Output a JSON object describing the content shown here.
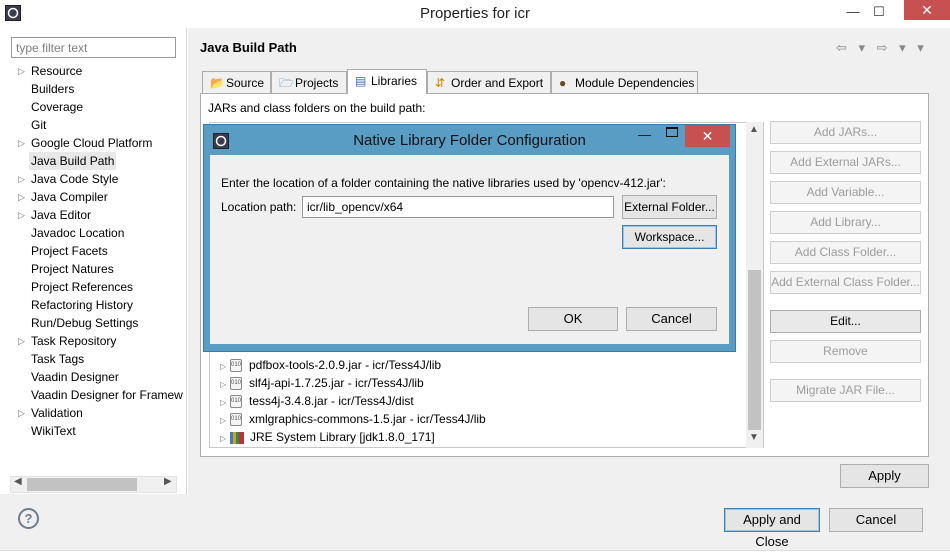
{
  "window": {
    "title": "Properties for icr",
    "minimize": "—",
    "maximize": "☐",
    "close": "✕"
  },
  "filter": {
    "placeholder": "type filter text"
  },
  "nav": [
    {
      "label": "Resource",
      "expandable": true
    },
    {
      "label": "Builders",
      "expandable": false
    },
    {
      "label": "Coverage",
      "expandable": false
    },
    {
      "label": "Git",
      "expandable": false
    },
    {
      "label": "Google Cloud Platform",
      "expandable": true
    },
    {
      "label": "Java Build Path",
      "expandable": false,
      "selected": true
    },
    {
      "label": "Java Code Style",
      "expandable": true
    },
    {
      "label": "Java Compiler",
      "expandable": true
    },
    {
      "label": "Java Editor",
      "expandable": true
    },
    {
      "label": "Javadoc Location",
      "expandable": false
    },
    {
      "label": "Project Facets",
      "expandable": false
    },
    {
      "label": "Project Natures",
      "expandable": false
    },
    {
      "label": "Project References",
      "expandable": false
    },
    {
      "label": "Refactoring History",
      "expandable": false
    },
    {
      "label": "Run/Debug Settings",
      "expandable": false
    },
    {
      "label": "Task Repository",
      "expandable": true
    },
    {
      "label": "Task Tags",
      "expandable": false
    },
    {
      "label": "Vaadin Designer",
      "expandable": false
    },
    {
      "label": "Vaadin Designer for Framew",
      "expandable": false
    },
    {
      "label": "Validation",
      "expandable": true
    },
    {
      "label": "WikiText",
      "expandable": false
    }
  ],
  "page": {
    "title": "Java Build Path",
    "nav_glyphs": "⇦ ▾ ⇨ ▾ ▾"
  },
  "tabs": [
    {
      "label": "Source",
      "icon": "source-folder-icon"
    },
    {
      "label": "Projects",
      "icon": "projects-icon"
    },
    {
      "label": "Libraries",
      "icon": "libraries-icon",
      "active": true
    },
    {
      "label": "Order and Export",
      "icon": "order-export-icon"
    },
    {
      "label": "Module Dependencies",
      "icon": "module-icon"
    }
  ],
  "libraries": {
    "caption": "JARs and class folders on the build path:",
    "rows": [
      {
        "label": "pdfbox-tools-2.0.9.jar - icr/Tess4J/lib",
        "kind": "jar"
      },
      {
        "label": "slf4j-api-1.7.25.jar - icr/Tess4J/lib",
        "kind": "jar"
      },
      {
        "label": "tess4j-3.4.8.jar - icr/Tess4J/dist",
        "kind": "jar"
      },
      {
        "label": "xmlgraphics-commons-1.5.jar - icr/Tess4J/lib",
        "kind": "jar"
      },
      {
        "label": "JRE System Library [jdk1.8.0_171]",
        "kind": "lib"
      }
    ]
  },
  "side_buttons": [
    {
      "label": "Add JARs...",
      "enabled": false
    },
    {
      "label": "Add External JARs...",
      "enabled": false
    },
    {
      "label": "Add Variable...",
      "enabled": false
    },
    {
      "label": "Add Library...",
      "enabled": false
    },
    {
      "label": "Add Class Folder...",
      "enabled": false
    },
    {
      "label": "Add External Class Folder...",
      "enabled": false
    },
    {
      "label": "Edit...",
      "enabled": true
    },
    {
      "label": "Remove",
      "enabled": false
    },
    {
      "label": "Migrate JAR File...",
      "enabled": false
    }
  ],
  "apply": "Apply",
  "footer": {
    "help": "?",
    "apply_close": "Apply and Close",
    "cancel": "Cancel"
  },
  "dialog": {
    "title": "Native Library Folder Configuration",
    "message": "Enter the location of a folder containing the native libraries used by 'opencv-412.jar':",
    "location_label": "Location path:",
    "location_value": "icr/lib_opencv/x64",
    "external_folder": "External Folder...",
    "workspace": "Workspace...",
    "ok": "OK",
    "cancel": "Cancel",
    "close": "✕"
  }
}
